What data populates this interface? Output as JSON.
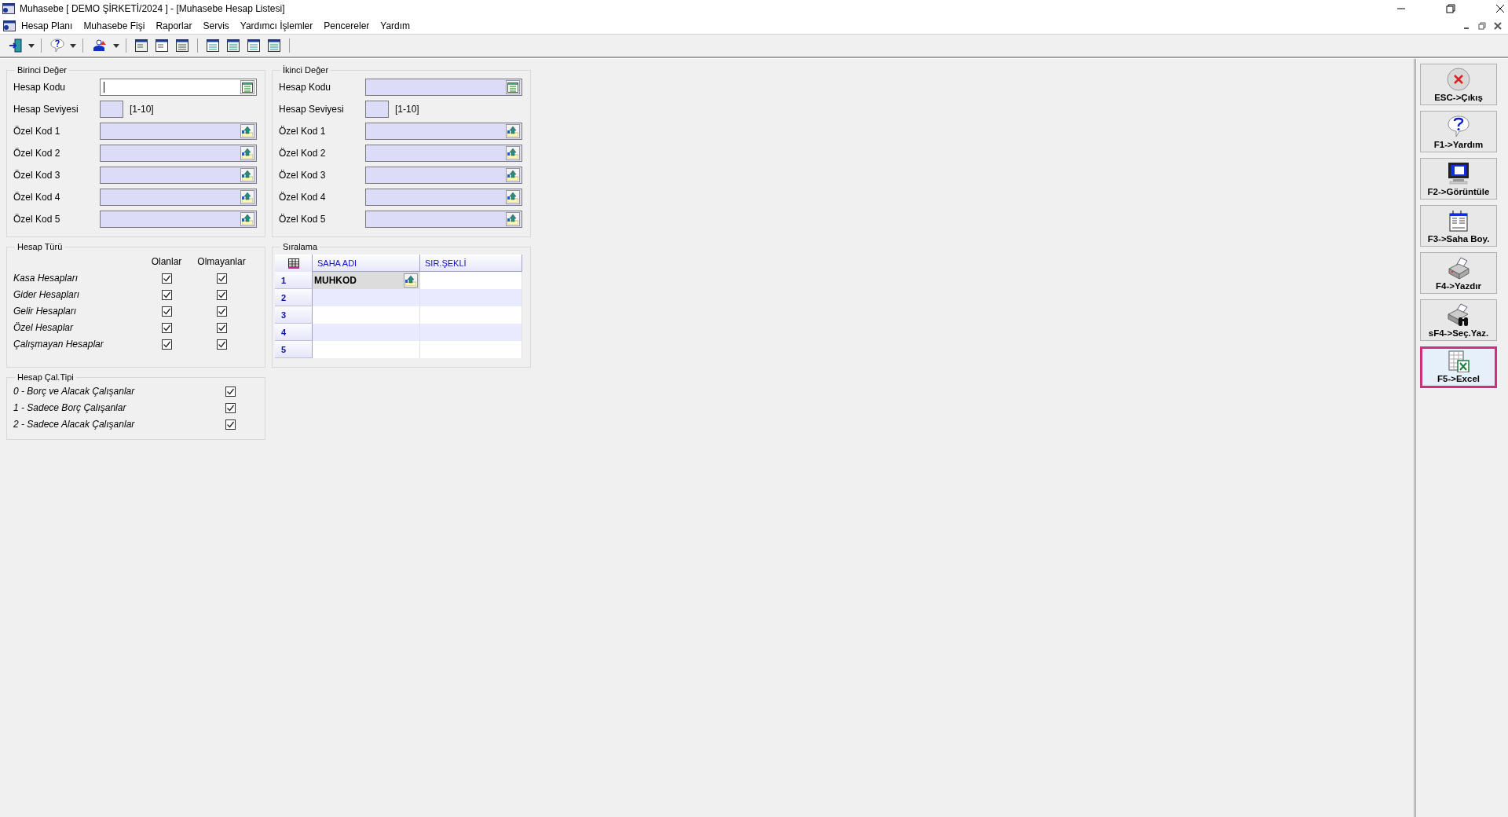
{
  "window": {
    "title": "Muhasebe [ DEMO ŞİRKETİ/2024 ]  - [Muhasebe Hesap Listesi]"
  },
  "menu": [
    "Hesap Planı",
    "Muhasebe Fişi",
    "Raporlar",
    "Servis",
    "Yardımcı İşlemler",
    "Pencereler",
    "Yardım"
  ],
  "panels": [
    {
      "title": "Birinci Değer",
      "fields": [
        {
          "label": "Hesap Kodu",
          "kind": "account",
          "focused": true
        },
        {
          "label": "Hesap Seviyesi",
          "kind": "level",
          "range": "[1-10]",
          "focused": false
        },
        {
          "label": "Özel Kod 1",
          "kind": "code",
          "focused": false
        },
        {
          "label": "Özel Kod 2",
          "kind": "code",
          "focused": false
        },
        {
          "label": "Özel Kod 3",
          "kind": "code",
          "focused": false
        },
        {
          "label": "Özel Kod 4",
          "kind": "code",
          "focused": false
        },
        {
          "label": "Özel Kod 5",
          "kind": "code",
          "focused": false
        }
      ]
    },
    {
      "title": "İkinci Değer",
      "fields": [
        {
          "label": "Hesap Kodu",
          "kind": "account",
          "focused": false
        },
        {
          "label": "Hesap Seviyesi",
          "kind": "level",
          "range": "[1-10]",
          "focused": false
        },
        {
          "label": "Özel Kod 1",
          "kind": "code",
          "focused": false
        },
        {
          "label": "Özel Kod 2",
          "kind": "code",
          "focused": false
        },
        {
          "label": "Özel Kod 3",
          "kind": "code",
          "focused": false
        },
        {
          "label": "Özel Kod 4",
          "kind": "code",
          "focused": false
        },
        {
          "label": "Özel Kod 5",
          "kind": "code",
          "focused": false
        }
      ]
    }
  ],
  "account_types": {
    "title": "Hesap Türü",
    "columns": [
      "Olanlar",
      "Olmayanlar"
    ],
    "rows": [
      {
        "label": "Kasa Hesapları",
        "included": true,
        "excluded": true
      },
      {
        "label": "Gider Hesapları",
        "included": true,
        "excluded": true
      },
      {
        "label": "Gelir Hesapları",
        "included": true,
        "excluded": true
      },
      {
        "label": "Özel Hesaplar",
        "included": true,
        "excluded": true
      },
      {
        "label": "Çalışmayan Hesaplar",
        "included": true,
        "excluded": true
      }
    ]
  },
  "sorting": {
    "title": "Sıralama",
    "columns": [
      "SAHA ADI",
      "SIR.ŞEKLİ"
    ],
    "rows": [
      {
        "number": "1",
        "field": "MUHKOD",
        "selected": true
      },
      {
        "number": "2",
        "selected": false
      },
      {
        "number": "3",
        "selected": false
      },
      {
        "number": "4",
        "selected": false
      },
      {
        "number": "5",
        "selected": false
      }
    ]
  },
  "working_type": {
    "title": "Hesap Çal.Tipi",
    "rows": [
      {
        "label": "0 - Borç ve Alacak Çalışanlar",
        "checked": true
      },
      {
        "label": "1 - Sadece Borç Çalışanlar",
        "checked": true
      },
      {
        "label": "2 - Sadece Alacak Çalışanlar",
        "checked": true
      }
    ]
  },
  "side_buttons": [
    {
      "label": "ESC->Çıkış",
      "kind": "exit",
      "selected": false
    },
    {
      "label": "F1->Yardım",
      "kind": "help",
      "selected": false
    },
    {
      "label": "F2->Görüntüle",
      "kind": "view",
      "selected": false
    },
    {
      "label": "F3->Saha Boy.",
      "kind": "columns",
      "selected": false
    },
    {
      "label": "F4->Yazdır",
      "kind": "print",
      "selected": false
    },
    {
      "label": "sF4->Seç.Yaz.",
      "kind": "select-print",
      "selected": false
    },
    {
      "label": "F5->Excel",
      "kind": "excel",
      "selected": true
    }
  ]
}
